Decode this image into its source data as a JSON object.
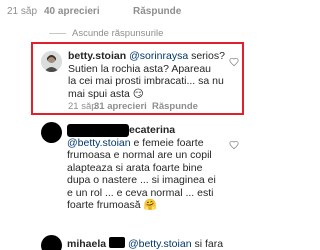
{
  "top_row": {
    "age": "21 săp",
    "likes": "40 aprecieri",
    "reply": "Răspunde"
  },
  "hide_replies": "Ascunde răspunsurile",
  "comments": [
    {
      "username": "betty.stoian",
      "mention": "@sorinraysa",
      "text": "serios? Sutien la rochia asta? Apareau la cei mai prosti imbracati... sa nu mai spui asta 😏",
      "lines": [
        "serios?",
        "Sutien la rochia asta? Apareau",
        "la cei mai prosti imbracati... sa nu",
        "mai spui asta 😏"
      ],
      "age": "21 săp",
      "likes": "31 aprecieri",
      "reply": "Răspunde"
    },
    {
      "username": "ecaterina",
      "mention": "@betty.stoian",
      "lines": [
        "e femeie foarte",
        "frumoasa e normal are un copil",
        "alapteaza si arata foarte bine",
        "dupa o nastere ... si imaginea ei",
        "e un rol ... e ceva normal ... esti",
        "foarte frumoasă 🤗"
      ]
    },
    {
      "username": "mihaela",
      "mention": "@betty.stoian",
      "lines": [
        "si fara"
      ]
    }
  ],
  "colors": {
    "highlight": "#e0202a",
    "mention": "#00376b",
    "meta": "#8e8e8e"
  }
}
